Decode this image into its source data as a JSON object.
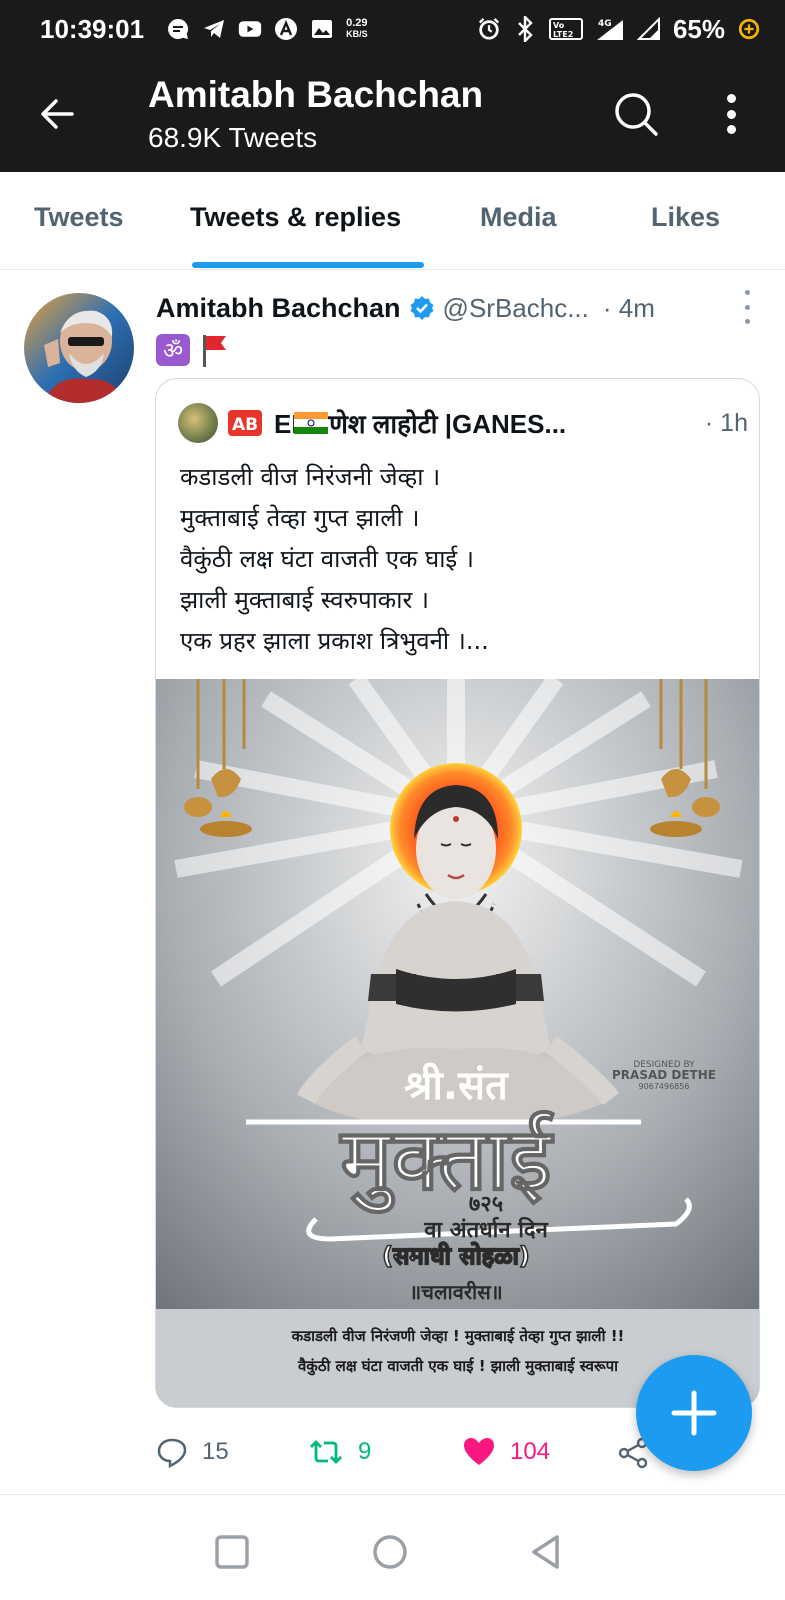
{
  "status_bar": {
    "time": "10:39:01",
    "speed_value": "0.29",
    "speed_unit": "KB/S",
    "volte_label": "Vo LTE 2",
    "network": "4G",
    "battery": "65%"
  },
  "header": {
    "title": "Amitabh Bachchan",
    "subtitle": "68.9K Tweets"
  },
  "tabs": [
    {
      "label": "Tweets",
      "active": false
    },
    {
      "label": "Tweets & replies",
      "active": true
    },
    {
      "label": "Media",
      "active": false
    },
    {
      "label": "Likes",
      "active": false
    }
  ],
  "tweet": {
    "author": "Amitabh Bachchan",
    "handle": "@SrBachc...",
    "time": "· 4m",
    "text_symbol": "ॐ",
    "quoted": {
      "badge": "AB",
      "name": "EF  गणेश लाहोटी |GANES...",
      "time": "· 1h",
      "lines": [
        "कडाडली वीज निरंजनी जेव्हा ।",
        "मुक्ताबाई तेव्हा गुप्त झाली ।",
        "वैकुंठी लक्ष घंटा वाजती एक घाई ।",
        "झाली मुक्ताबाई स्वरुपाकार ।",
        "एक प्रहर झाला प्रकाश त्रिभुवनी ।..."
      ],
      "image": {
        "designer_label": "DESIGNED BY",
        "designer_name": "PRASAD DETHE",
        "designer_phone": "9067496856",
        "title_small": "श्री.संत",
        "title_big": "मुक्ताई",
        "number": "७२५",
        "line1": "वा अंतर्धान दिन",
        "line2": "(समाधी सोहळा)",
        "brand": "॥चलावरीस॥",
        "caption1": "कडाडली वीज निरंजणी जेव्हा ! मुक्ताबाई तेव्हा गुप्त झाली !!",
        "caption2": "वैकुंठी लक्ष घंटा वाजती एक घाई ! झाली मुक्ताबाई स्वरूपा"
      }
    },
    "actions": {
      "replies": "15",
      "retweets": "9",
      "likes": "104"
    }
  },
  "colors": {
    "accent": "#1d9bf0",
    "retweet": "#00ba7c",
    "like": "#f91880",
    "header_bg": "#1a1a1c"
  }
}
